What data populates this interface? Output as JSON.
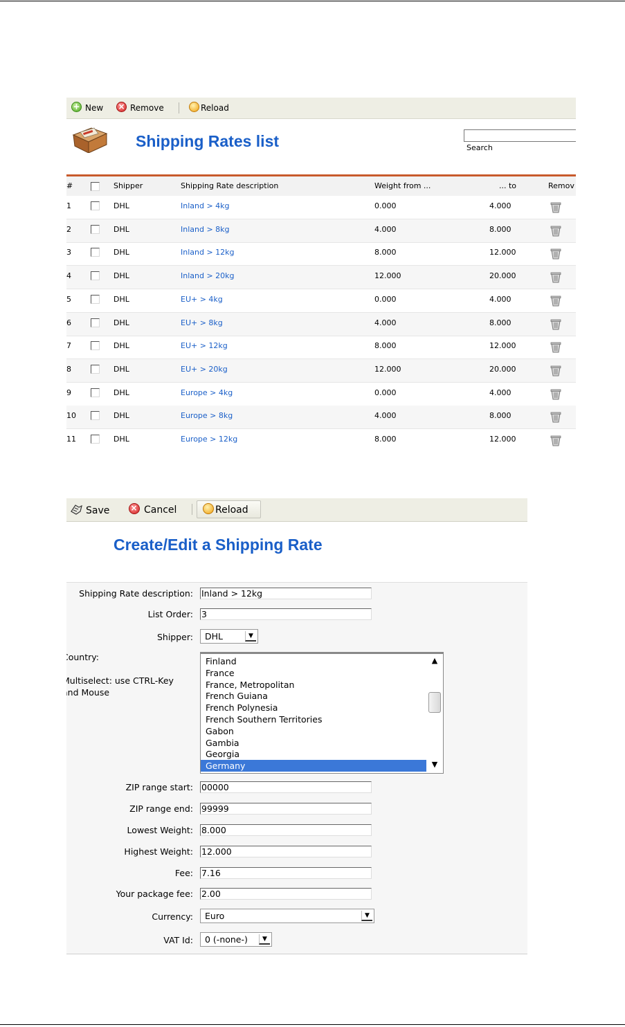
{
  "list_view": {
    "toolbar": {
      "new_label": "New",
      "remove_label": "Remove",
      "reload_label": "Reload"
    },
    "title": "Shipping Rates list",
    "search": {
      "value": "",
      "label": "Search"
    },
    "columns": {
      "num": "#",
      "shipper": "Shipper",
      "description": "Shipping Rate description",
      "weight_from": "Weight from ...",
      "weight_to": "... to",
      "remove": "Remov"
    },
    "rows": [
      {
        "num": "1",
        "shipper": "DHL",
        "description": "Inland > 4kg",
        "from": "0.000",
        "to": "4.000"
      },
      {
        "num": "2",
        "shipper": "DHL",
        "description": "Inland > 8kg",
        "from": "4.000",
        "to": "8.000"
      },
      {
        "num": "3",
        "shipper": "DHL",
        "description": "Inland > 12kg",
        "from": "8.000",
        "to": "12.000"
      },
      {
        "num": "4",
        "shipper": "DHL",
        "description": "Inland > 20kg",
        "from": "12.000",
        "to": "20.000"
      },
      {
        "num": "5",
        "shipper": "DHL",
        "description": "EU+ > 4kg",
        "from": "0.000",
        "to": "4.000"
      },
      {
        "num": "6",
        "shipper": "DHL",
        "description": "EU+ > 8kg",
        "from": "4.000",
        "to": "8.000"
      },
      {
        "num": "7",
        "shipper": "DHL",
        "description": "EU+ > 12kg",
        "from": "8.000",
        "to": "12.000"
      },
      {
        "num": "8",
        "shipper": "DHL",
        "description": "EU+ > 20kg",
        "from": "12.000",
        "to": "20.000"
      },
      {
        "num": "9",
        "shipper": "DHL",
        "description": "Europe > 4kg",
        "from": "0.000",
        "to": "4.000"
      },
      {
        "num": "10",
        "shipper": "DHL",
        "description": "Europe > 8kg",
        "from": "4.000",
        "to": "8.000"
      },
      {
        "num": "11",
        "shipper": "DHL",
        "description": "Europe > 12kg",
        "from": "8.000",
        "to": "12.000"
      }
    ]
  },
  "edit_view": {
    "toolbar": {
      "save_label": "Save",
      "cancel_label": "Cancel",
      "reload_label": "Reload"
    },
    "title": "Create/Edit a Shipping Rate",
    "fields": {
      "description": {
        "label": "Shipping Rate description:",
        "value": "Inland > 12kg"
      },
      "list_order": {
        "label": "List Order:",
        "value": "3"
      },
      "shipper": {
        "label": "Shipper:",
        "value": "DHL"
      },
      "country": {
        "label": "Country:",
        "hint_line1": "Multiselect: use CTRL-Key",
        "hint_line2": "and Mouse",
        "options": [
          "Finland",
          "France",
          "France, Metropolitan",
          "French Guiana",
          "French Polynesia",
          "French Southern Territories",
          "Gabon",
          "Gambia",
          "Georgia",
          "Germany"
        ],
        "selected": "Germany"
      },
      "zip_start": {
        "label": "ZIP range start:",
        "value": "00000"
      },
      "zip_end": {
        "label": "ZIP range end:",
        "value": "99999"
      },
      "lowest_weight": {
        "label": "Lowest Weight:",
        "value": "8.000"
      },
      "highest_weight": {
        "label": "Highest Weight:",
        "value": "12.000"
      },
      "fee": {
        "label": "Fee:",
        "value": "7.16"
      },
      "package_fee": {
        "label": "Your package fee:",
        "value": "2.00"
      },
      "currency": {
        "label": "Currency:",
        "value": "Euro"
      },
      "vat": {
        "label": "VAT Id:",
        "value": "0 (-none-)"
      }
    }
  },
  "colors": {
    "title_blue": "#1a5fc8",
    "link_blue": "#1a5fc8",
    "toolbar_bg": "#eeeee4",
    "accent_rule": "#c85a2c",
    "selection": "#3b78d8"
  }
}
